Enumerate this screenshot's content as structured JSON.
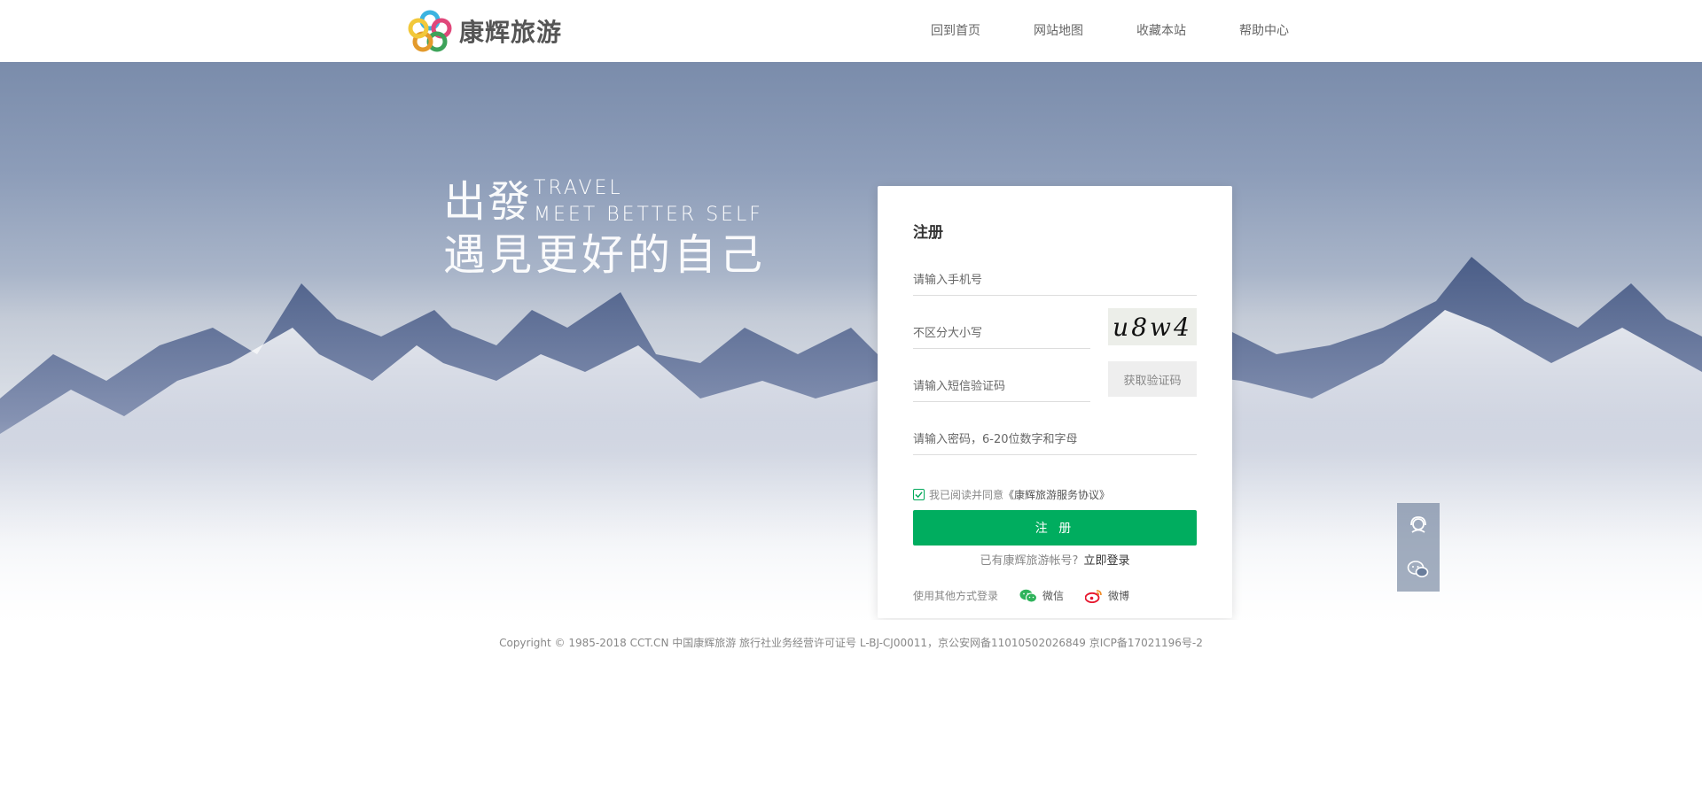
{
  "header": {
    "brand": "康辉旅游",
    "nav": [
      {
        "label": "回到首页"
      },
      {
        "label": "网站地图"
      },
      {
        "label": "收藏本站"
      },
      {
        "label": "帮助中心"
      }
    ]
  },
  "hero": {
    "slogan_cn_1": "出發",
    "slogan_en_1": "TRAVEL",
    "slogan_en_2": "MEET BETTER SELF",
    "slogan_cn_2": "遇見更好的自己"
  },
  "register": {
    "title": "注册",
    "phone_placeholder": "请输入手机号",
    "captcha_placeholder": "不区分大小写",
    "captcha_text": "u8w4",
    "sms_placeholder": "请输入短信验证码",
    "sms_button": "获取验证码",
    "password_placeholder": "请输入密码，6-20位数字和字母",
    "agree_prefix": "我已阅读并同意",
    "agree_link": "《康辉旅游服务协议》",
    "agree_checked": true,
    "submit_label": "注 册",
    "has_account_text": "已有康辉旅游帐号?",
    "login_link": "立即登录",
    "other_login_text": "使用其他方式登录",
    "wechat_label": "微信",
    "weibo_label": "微博"
  },
  "side_panel": {
    "icons": [
      "customer-service-icon",
      "wechat-chat-icon"
    ]
  },
  "footer": {
    "copyright": "Copyright © 1985-2018 CCT.CN 中国康辉旅游 旅行社业务经营许可证号 L-BJ-CJ00011，京公安网备11010502026849 京ICP备17021196号-2"
  },
  "colors": {
    "primary_green": "#00ad5f",
    "sky_top": "#7a8cab"
  }
}
